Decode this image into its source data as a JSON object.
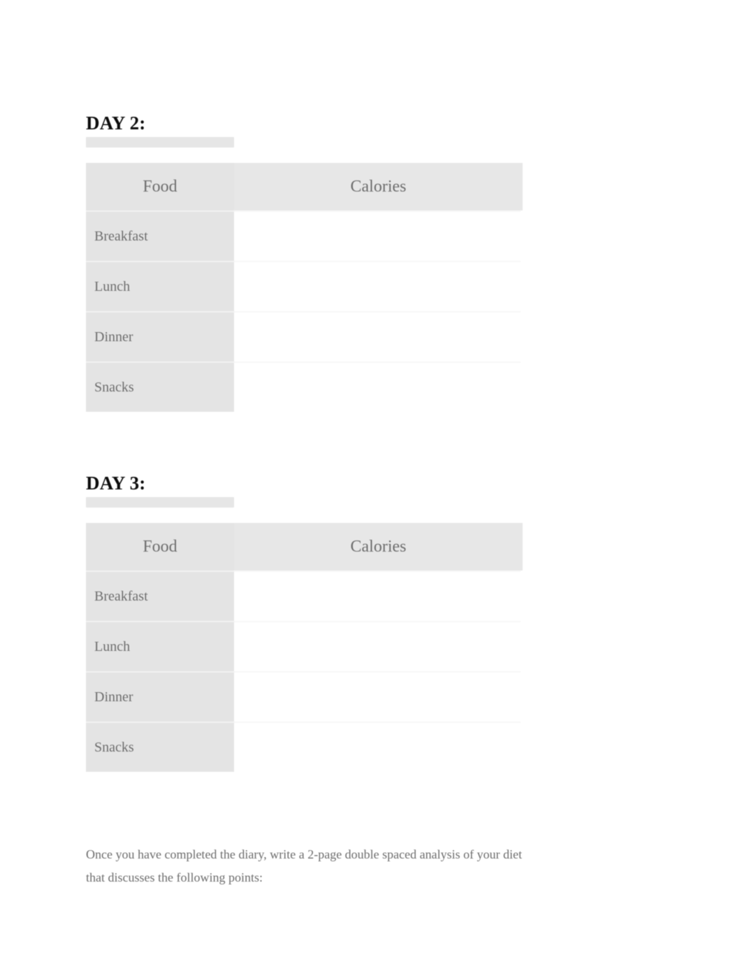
{
  "document": {
    "sections": [
      {
        "heading": "DAY 2:",
        "table": {
          "columns": [
            "Food",
            "Calories"
          ],
          "rows": [
            {
              "label": "Breakfast",
              "calories": ""
            },
            {
              "label": "Lunch",
              "calories": ""
            },
            {
              "label": "Dinner",
              "calories": ""
            },
            {
              "label": "Snacks",
              "calories": ""
            }
          ]
        }
      },
      {
        "heading": "DAY 3:",
        "table": {
          "columns": [
            "Food",
            "Calories"
          ],
          "rows": [
            {
              "label": "Breakfast",
              "calories": ""
            },
            {
              "label": "Lunch",
              "calories": ""
            },
            {
              "label": "Dinner",
              "calories": ""
            },
            {
              "label": "Snacks",
              "calories": ""
            }
          ]
        }
      }
    ],
    "closing_paragraph": "Once you have completed the diary, write a 2-page double spaced analysis of your diet that discusses the following points:"
  },
  "colors": {
    "heading_text": "#0d0d0d",
    "body_text": "#6c6c6c",
    "table_header_bg": "#e6e6e6",
    "label_cell_bg": "#e4e4e4",
    "value_cell_bg": "#ffffff",
    "page_bg": "#ffffff"
  }
}
